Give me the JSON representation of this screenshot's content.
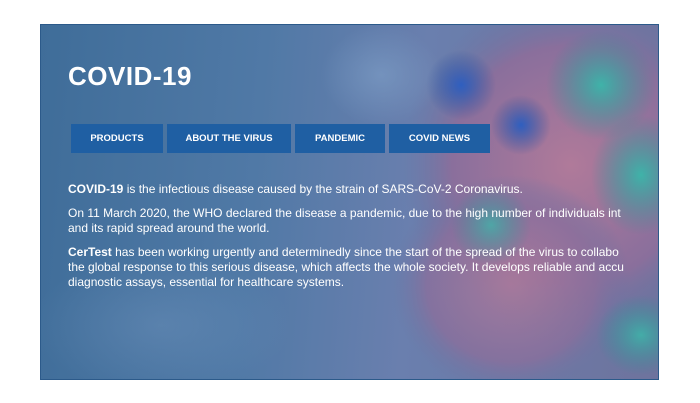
{
  "hero": {
    "title": "COVID-19"
  },
  "nav": {
    "items": [
      {
        "label": "PRODUCTS"
      },
      {
        "label": "ABOUT THE VIRUS"
      },
      {
        "label": "PANDEMIC"
      },
      {
        "label": "COVID NEWS"
      }
    ]
  },
  "content": {
    "p1_bold": "COVID-19",
    "p1_text": " is the infectious disease caused by the strain of SARS-CoV-2 Coronavirus.",
    "p2_line1": "On 11 March 2020, the WHO declared the disease a pandemic, due to the high number of individuals int",
    "p2_line2": "and its rapid spread around the world.",
    "p3_bold": "CerTest",
    "p3_line1": " has been working urgently and determinedly since the start of the spread of the virus to collabo",
    "p3_line2": "the global response to this serious disease, which affects the whole society. It develops reliable and accu",
    "p3_line3": "diagnostic assays, essential for healthcare systems."
  },
  "colors": {
    "nav_button_bg": "#1f5fa3",
    "hero_bg": "#5079a6",
    "text": "#ffffff"
  }
}
